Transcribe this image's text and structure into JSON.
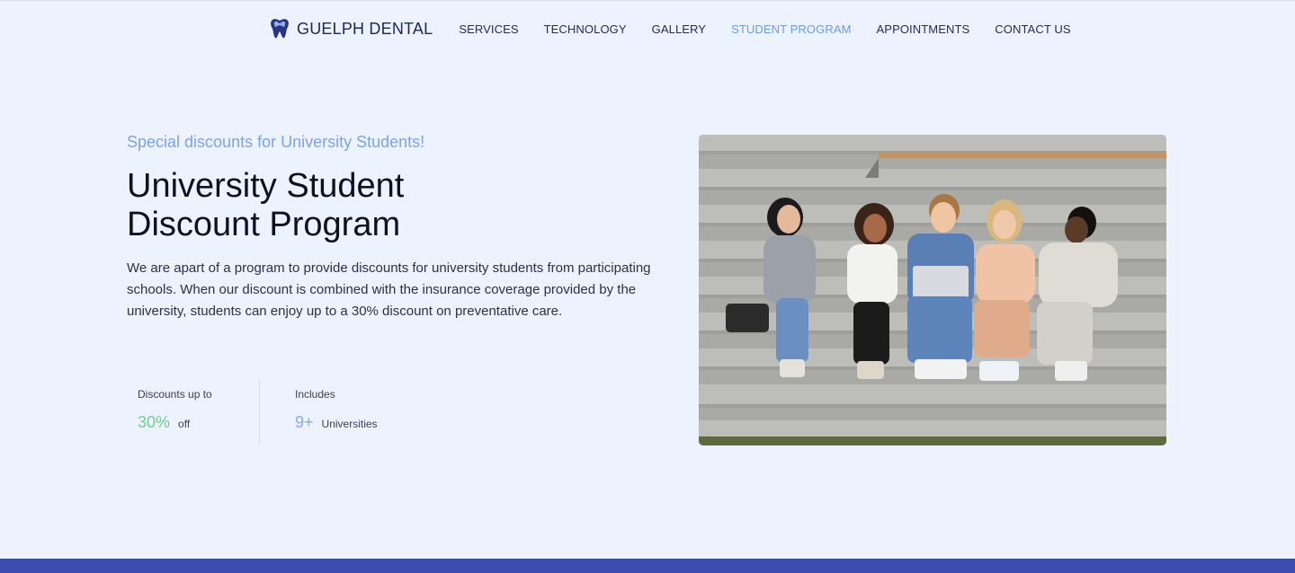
{
  "brand": {
    "name": "GUELPH DENTAL",
    "icon": "tooth-icon"
  },
  "nav": {
    "items": [
      {
        "label": "SERVICES",
        "active": false
      },
      {
        "label": "TECHNOLOGY",
        "active": false
      },
      {
        "label": "GALLERY",
        "active": false
      },
      {
        "label": "STUDENT PROGRAM",
        "active": true
      },
      {
        "label": "APPOINTMENTS",
        "active": false
      },
      {
        "label": "CONTACT US",
        "active": false
      }
    ]
  },
  "hero": {
    "eyebrow": "Special discounts for University Students!",
    "title_line1": "University Student",
    "title_line2": "Discount Program",
    "description": "We are apart of a program to provide discounts for university students from participating schools. When our discount is combined with the insurance coverage provided by the university, students can enjoy up to a 30% discount on preventative care."
  },
  "stats": [
    {
      "label": "Discounts up to",
      "value": "30%",
      "unit": "off"
    },
    {
      "label": "Includes",
      "value": "9+",
      "unit": "Universities"
    }
  ],
  "colors": {
    "background": "#ecf2fe",
    "accent": "#7fa2e8",
    "active_nav": "#6f9ae6",
    "stat_green": "#6fcf8f",
    "stat_blue": "#8aa6ee",
    "footer_bar": "#3a4dae"
  }
}
